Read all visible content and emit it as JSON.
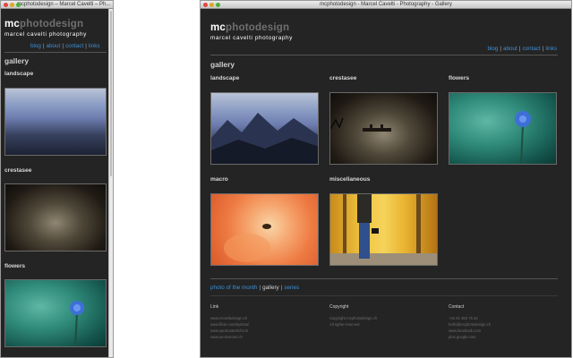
{
  "small_window": {
    "title": "mcphotodesign – Marcel Cavelti – Ph..."
  },
  "large_window": {
    "title": "mcphotodesign - Marcel Cavelti - Photography - Gallery"
  },
  "site": {
    "logo_mc": "mc",
    "logo_rest": "photodesign",
    "tagline": "marcel cavelti photography",
    "nav": [
      "blog",
      "about",
      "contact",
      "links"
    ],
    "page_heading": "gallery"
  },
  "gallery": {
    "categories": [
      "landscape",
      "crestasee",
      "flowers",
      "macro",
      "miscellaneous"
    ]
  },
  "subnav": {
    "items": [
      "photo of the month",
      "gallery",
      "series"
    ],
    "current": "gallery"
  },
  "footer": {
    "link": {
      "heading": "Link",
      "items": [
        "www.mcwebdesign.ch",
        "www.flickr.com/bynbsa/",
        "www.sportunterricht.ch",
        "www.ae-lessons.ch"
      ]
    },
    "copyright": {
      "heading": "Copyright",
      "lines": [
        "Copyright mcphotodesign.ch",
        "All rights reserved"
      ]
    },
    "contact": {
      "heading": "Contact",
      "items": [
        "+41 81 353 75 32",
        "hello@mcphotodesign.ch",
        "www.facebook.com",
        "plus.google.com"
      ]
    }
  },
  "colors": {
    "page_bg": "#242424",
    "link": "#3d8fd8",
    "heading": "#d8d8d8"
  }
}
